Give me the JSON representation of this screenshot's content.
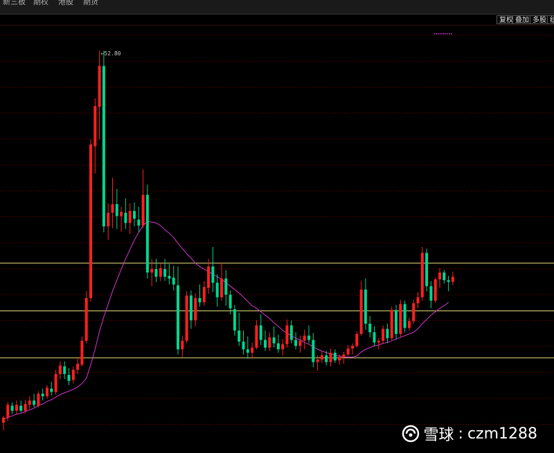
{
  "tabs": [
    "新三板",
    "期权",
    "港股",
    "期货"
  ],
  "toolbar": [
    "复权",
    "叠加",
    "多股",
    "统"
  ],
  "watermark": {
    "site": "雪球",
    "separator": ":",
    "user": "czm1288"
  },
  "colors": {
    "up": "#ff2020",
    "down": "#00d68f",
    "ma": "#d23ad2",
    "grid": "#6b0000",
    "level": "#e8e07a",
    "marker": "#d23ad2"
  },
  "chart_data": {
    "type": "candlestick",
    "max_label": "52.80",
    "price_range": [
      8,
      55
    ],
    "horizontal_levels": [
      27.9,
      22.3,
      16.8
    ],
    "candles": [
      [
        9.2,
        10.0,
        8.3,
        9.8
      ],
      [
        9.8,
        11.6,
        9.4,
        11.3
      ],
      [
        11.2,
        11.6,
        10.2,
        10.6
      ],
      [
        10.6,
        11.8,
        10.2,
        11.3
      ],
      [
        11.2,
        11.8,
        10.4,
        10.6
      ],
      [
        10.6,
        11.9,
        10.3,
        11.4
      ],
      [
        11.3,
        12.3,
        10.8,
        11.8
      ],
      [
        11.8,
        12.6,
        11.0,
        11.3
      ],
      [
        11.2,
        12.9,
        11.0,
        12.6
      ],
      [
        12.6,
        13.2,
        11.8,
        12.3
      ],
      [
        12.3,
        13.6,
        12.0,
        13.3
      ],
      [
        13.2,
        14.0,
        12.4,
        12.8
      ],
      [
        12.8,
        15.4,
        12.5,
        14.9
      ],
      [
        14.9,
        16.4,
        14.3,
        15.9
      ],
      [
        15.8,
        16.4,
        14.3,
        14.9
      ],
      [
        14.8,
        15.6,
        13.6,
        14.1
      ],
      [
        14.2,
        15.8,
        13.8,
        15.4
      ],
      [
        15.4,
        16.9,
        14.9,
        16.1
      ],
      [
        16.0,
        19.3,
        15.8,
        18.8
      ],
      [
        18.8,
        24.6,
        18.5,
        23.8
      ],
      [
        23.8,
        42.4,
        23.4,
        41.8
      ],
      [
        41.6,
        47.2,
        38.4,
        46.3
      ],
      [
        46.2,
        52.8,
        42.4,
        51.0
      ],
      [
        51.0,
        52.8,
        31.5,
        32.2
      ],
      [
        32.2,
        34.9,
        30.6,
        33.8
      ],
      [
        33.8,
        37.9,
        32.0,
        34.8
      ],
      [
        34.8,
        36.6,
        31.9,
        33.4
      ],
      [
        33.4,
        34.5,
        31.6,
        33.9
      ],
      [
        33.8,
        35.5,
        31.9,
        32.6
      ],
      [
        32.6,
        34.9,
        31.3,
        34.0
      ],
      [
        34.0,
        35.0,
        32.2,
        33.1
      ],
      [
        33.0,
        34.5,
        31.6,
        32.3
      ],
      [
        32.3,
        38.9,
        32.0,
        35.9
      ],
      [
        35.9,
        37.1,
        26.1,
        26.8
      ],
      [
        26.8,
        28.4,
        25.2,
        27.2
      ],
      [
        27.2,
        28.4,
        25.7,
        26.3
      ],
      [
        26.3,
        27.9,
        25.8,
        27.3
      ],
      [
        27.2,
        28.4,
        25.8,
        26.3
      ],
      [
        26.4,
        27.8,
        25.4,
        26.1
      ],
      [
        26.2,
        27.6,
        24.7,
        25.4
      ],
      [
        25.3,
        27.5,
        17.2,
        17.8
      ],
      [
        17.8,
        19.4,
        16.9,
        18.8
      ],
      [
        18.8,
        24.6,
        18.5,
        24.1
      ],
      [
        24.1,
        24.7,
        20.2,
        21.2
      ],
      [
        21.2,
        24.4,
        20.5,
        23.8
      ],
      [
        23.8,
        25.4,
        22.8,
        23.3
      ],
      [
        23.3,
        25.8,
        22.9,
        25.1
      ],
      [
        25.0,
        28.4,
        24.3,
        27.5
      ],
      [
        27.5,
        29.8,
        24.5,
        25.6
      ],
      [
        25.6,
        26.6,
        22.8,
        23.9
      ],
      [
        23.9,
        27.9,
        23.5,
        26.1
      ],
      [
        26.1,
        27.1,
        22.9,
        24.2
      ],
      [
        24.2,
        24.7,
        21.9,
        22.6
      ],
      [
        22.5,
        23.0,
        19.4,
        20.0
      ],
      [
        20.0,
        22.1,
        18.2,
        18.7
      ],
      [
        18.7,
        20.0,
        17.2,
        17.8
      ],
      [
        17.8,
        19.3,
        16.7,
        17.4
      ],
      [
        17.4,
        18.6,
        16.7,
        18.0
      ],
      [
        18.0,
        21.2,
        17.8,
        20.6
      ],
      [
        20.6,
        21.9,
        18.3,
        18.9
      ],
      [
        18.9,
        20.0,
        17.6,
        18.0
      ],
      [
        18.0,
        19.8,
        17.6,
        19.2
      ],
      [
        19.2,
        20.5,
        18.0,
        18.5
      ],
      [
        18.5,
        19.5,
        17.4,
        17.8
      ],
      [
        17.8,
        19.0,
        17.1,
        18.4
      ],
      [
        18.4,
        21.3,
        18.0,
        20.6
      ],
      [
        20.6,
        21.2,
        18.5,
        18.9
      ],
      [
        18.9,
        19.8,
        17.8,
        18.2
      ],
      [
        18.2,
        19.4,
        17.4,
        18.8
      ],
      [
        18.8,
        20.1,
        17.8,
        19.4
      ],
      [
        19.4,
        20.6,
        18.5,
        18.9
      ],
      [
        18.9,
        19.7,
        15.7,
        16.3
      ],
      [
        16.3,
        17.1,
        15.3,
        16.6
      ],
      [
        16.6,
        17.6,
        16.2,
        17.1
      ],
      [
        17.1,
        17.6,
        15.9,
        16.3
      ],
      [
        16.3,
        17.9,
        15.8,
        17.4
      ],
      [
        17.4,
        17.8,
        16.2,
        16.5
      ],
      [
        16.5,
        17.2,
        16.0,
        16.9
      ],
      [
        16.9,
        17.5,
        16.1,
        17.2
      ],
      [
        17.2,
        18.3,
        17.0,
        17.9
      ],
      [
        17.9,
        18.5,
        17.2,
        18.2
      ],
      [
        18.2,
        19.9,
        18.0,
        19.6
      ],
      [
        19.6,
        25.8,
        19.4,
        24.8
      ],
      [
        24.8,
        26.1,
        20.1,
        20.8
      ],
      [
        20.8,
        21.7,
        19.2,
        19.8
      ],
      [
        19.8,
        20.5,
        18.2,
        18.6
      ],
      [
        18.6,
        19.1,
        17.8,
        18.8
      ],
      [
        18.8,
        20.6,
        18.4,
        20.2
      ],
      [
        20.2,
        20.8,
        18.5,
        19.1
      ],
      [
        19.1,
        22.8,
        18.9,
        22.4
      ],
      [
        22.4,
        23.0,
        19.0,
        19.6
      ],
      [
        19.6,
        23.6,
        19.2,
        23.1
      ],
      [
        23.1,
        23.5,
        19.8,
        20.3
      ],
      [
        20.3,
        21.5,
        20.0,
        21.1
      ],
      [
        21.1,
        23.6,
        20.8,
        23.2
      ],
      [
        23.2,
        24.5,
        22.6,
        23.9
      ],
      [
        23.9,
        29.8,
        23.5,
        29.1
      ],
      [
        29.1,
        29.6,
        24.6,
        25.2
      ],
      [
        25.2,
        25.8,
        22.6,
        23.5
      ],
      [
        23.5,
        26.2,
        23.2,
        26.0
      ],
      [
        26.0,
        27.3,
        25.0,
        26.8
      ],
      [
        26.8,
        27.1,
        25.5,
        25.9
      ],
      [
        25.9,
        26.4,
        24.6,
        25.7
      ],
      [
        25.7,
        26.9,
        25.3,
        26.3
      ]
    ],
    "ma": [
      9.6,
      9.8,
      10.0,
      10.2,
      10.3,
      10.5,
      10.7,
      10.9,
      11.2,
      11.4,
      11.7,
      11.9,
      12.2,
      12.5,
      12.7,
      12.9,
      13.1,
      13.4,
      13.8,
      14.4,
      16.0,
      17.8,
      19.9,
      21.6,
      23.1,
      24.6,
      25.9,
      27.2,
      28.4,
      29.5,
      30.6,
      31.5,
      32.3,
      32.8,
      32.7,
      32.6,
      32.3,
      31.8,
      31.4,
      30.9,
      30.2,
      29.6,
      29.0,
      28.5,
      27.9,
      27.5,
      27.2,
      26.9,
      26.6,
      26.3,
      26.0,
      25.6,
      25.2,
      24.8,
      24.4,
      23.9,
      23.4,
      22.9,
      22.6,
      22.2,
      21.8,
      21.4,
      20.9,
      20.5,
      20.0,
      19.7,
      19.4,
      19.1,
      18.9,
      18.6,
      18.4,
      18.1,
      17.8,
      17.6,
      17.4,
      17.3,
      17.1,
      17.0,
      16.9,
      16.9,
      16.9,
      17.0,
      17.5,
      17.8,
      18.0,
      18.2,
      18.3,
      18.5,
      18.6,
      18.8,
      19.0,
      19.2,
      19.4,
      19.6,
      19.8,
      20.2,
      20.8,
      21.3,
      21.8,
      22.2,
      22.6,
      22.9,
      23.3
    ]
  }
}
